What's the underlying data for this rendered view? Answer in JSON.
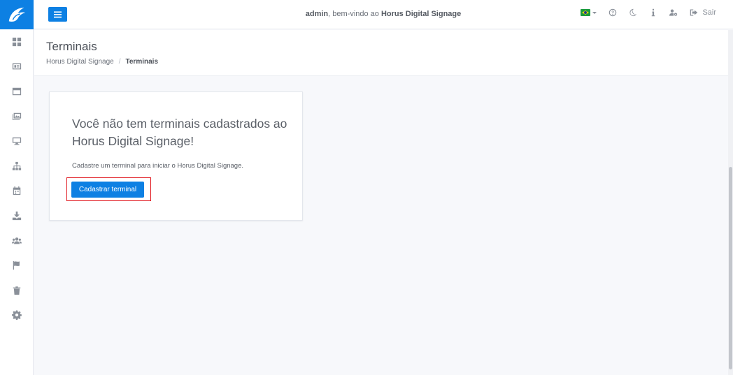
{
  "app": {
    "brand_color": "#0d80e3",
    "logo_icon": "eagle-logo-icon"
  },
  "sidebar": {
    "items": [
      {
        "icon": "dashboard-icon"
      },
      {
        "icon": "media-card-icon"
      },
      {
        "icon": "window-icon"
      },
      {
        "icon": "gallery-icon"
      },
      {
        "icon": "monitor-icon"
      },
      {
        "icon": "sitemap-icon"
      },
      {
        "icon": "calendar-icon"
      },
      {
        "icon": "download-icon"
      },
      {
        "icon": "users-icon"
      },
      {
        "icon": "flag-icon"
      },
      {
        "icon": "trash-icon"
      },
      {
        "icon": "gear-icon"
      }
    ]
  },
  "topbar": {
    "welcome_user": "admin",
    "welcome_middle": ", bem-vindo ao ",
    "welcome_app": "Horus Digital Signage",
    "language_icon": "brazil-flag-icon",
    "logout_label": "Sair"
  },
  "header": {
    "title": "Terminais",
    "breadcrumb_root": "Horus Digital Signage",
    "breadcrumb_separator": "/",
    "breadcrumb_current": "Terminais"
  },
  "empty_state": {
    "title": "Você não tem terminais cadastrados ao Horus Digital Signage!",
    "text": "Cadastre um terminal para iniciar o Horus Digital Signage.",
    "button_label": "Cadastrar terminal",
    "highlight_color": "#e0151c"
  }
}
